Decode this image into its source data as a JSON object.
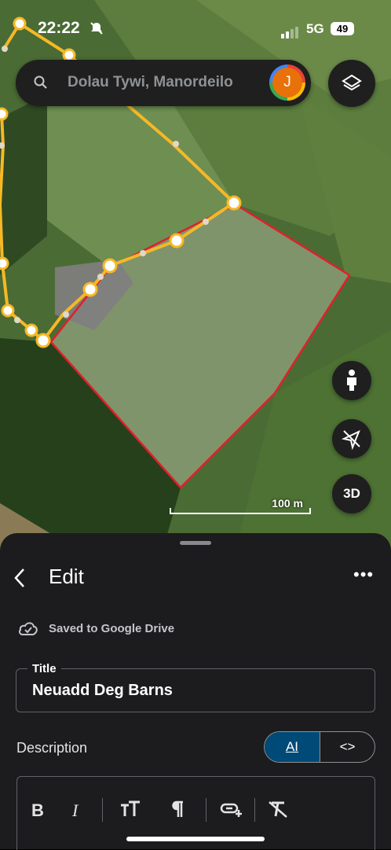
{
  "status_bar": {
    "time": "22:22",
    "network": "5G",
    "battery": "49",
    "mute_icon": "bell-slash-icon"
  },
  "search": {
    "text": "Dolau Tywi, Manordeilo",
    "icon": "search-icon"
  },
  "account": {
    "initial": "J",
    "color": "#e8710a"
  },
  "map": {
    "scale_label": "100 m",
    "buttons": {
      "layers": "layers-icon",
      "street_view": "pegman-icon",
      "north": "compass-off-icon",
      "three_d": "3D"
    },
    "path_color": "#f6b826",
    "polygon_color": "#e0202a"
  },
  "panel": {
    "header": "Edit",
    "back_icon": "chevron-left-icon",
    "more_icon": "more-horizontal-icon",
    "more_label": "•••",
    "save_status": "Saved to Google Drive",
    "title_label": "Title",
    "title_value": "Neuadd Deg Barns",
    "description_label": "Description",
    "mode_ai": "AI",
    "mode_code": "<>",
    "ai_color": "#004a77",
    "toolbar": [
      "bold-icon",
      "italic-icon",
      "text-size-icon",
      "paragraph-icon",
      "add-link-icon",
      "clear-format-icon"
    ]
  }
}
